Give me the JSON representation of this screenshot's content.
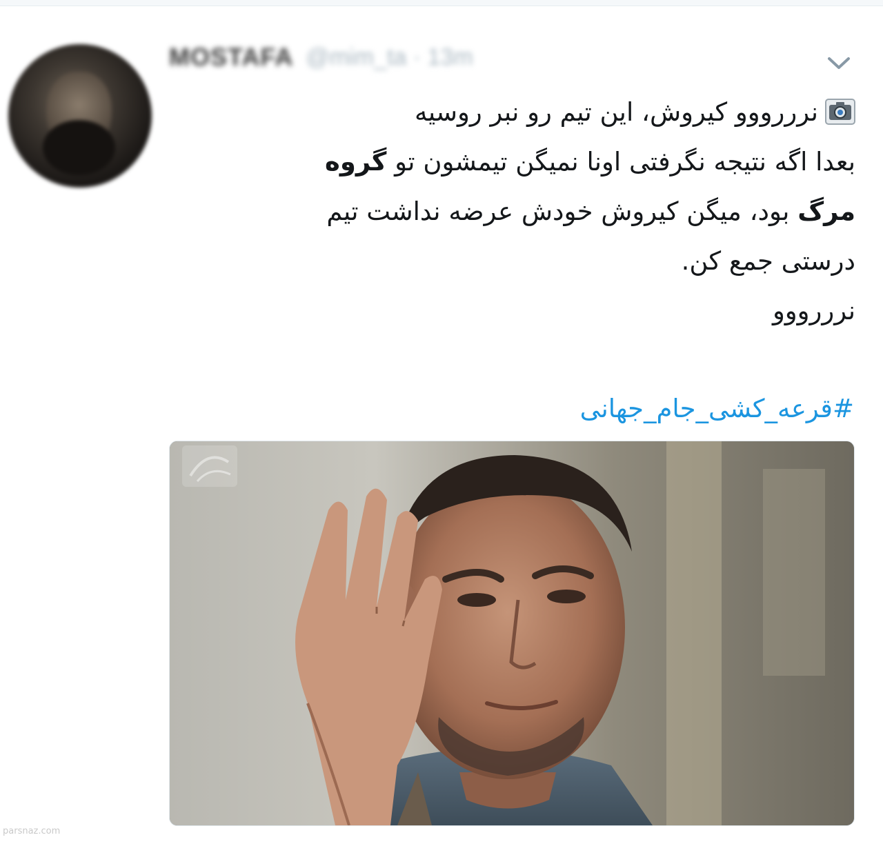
{
  "tweet": {
    "display_name": "MOSTAFA",
    "handle_time": "@mim_ta · 13m",
    "text_lines": [
      "نرررووو کیروش، این تیم رو نبر روسیه",
      "بعدا اگه نتیجه نگرفتی اونا نمیگن تیمشون تو",
      "گروه",
      "مرگ",
      "بود، میگن کیروش خودش عرضه نداشت تیم",
      "درستی جمع کن.",
      "نرررووو"
    ],
    "hashtag": "#قرعه_کشی_جام_جهانی"
  },
  "icons": {
    "chevron": "chevron-down-icon",
    "camera": "camera-icon"
  },
  "colors": {
    "text": "#14171a",
    "hashtag": "#1b95e0",
    "muted": "#aab8c2"
  },
  "watermark": "parsnaz.com"
}
